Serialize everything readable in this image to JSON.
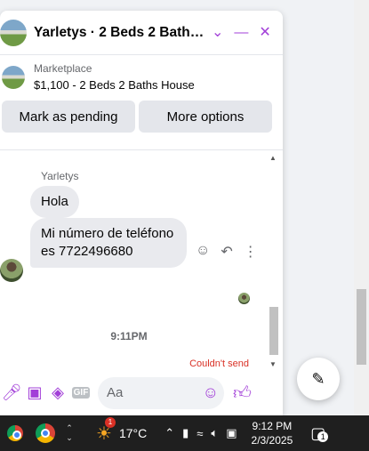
{
  "chat": {
    "title": "Yarletys · 2 Beds 2 Baths H...",
    "header_icons": [
      "chevron-down-icon",
      "minimize-icon",
      "close-icon"
    ],
    "marketplace_label": "Marketplace",
    "listing": "$1,100 - 2 Beds 2 Baths House",
    "buttons": {
      "pending": "Mark as pending",
      "more": "More options"
    },
    "sender_name": "Yarletys",
    "messages": [
      "Hola",
      "Mi número de teléfono es 7722496680"
    ],
    "timestamp": "9:11PM",
    "status": "Couldn't send",
    "composer_placeholder": "Aa",
    "accent_color": "#a23fd8"
  },
  "taskbar": {
    "temperature": "17°C",
    "weather_badge": "1",
    "time": "9:12 PM",
    "date": "2/3/2025",
    "notification_count": "1"
  }
}
